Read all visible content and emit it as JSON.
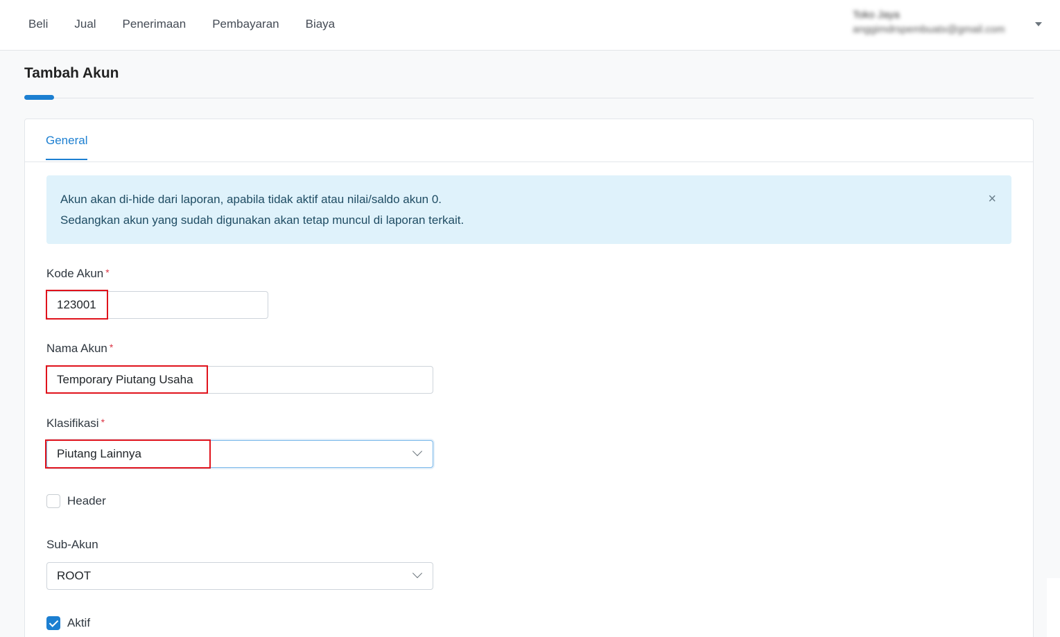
{
  "nav": {
    "items": [
      "Beli",
      "Jual",
      "Penerimaan",
      "Pembayaran",
      "Biaya"
    ]
  },
  "user": {
    "name": "Toko Jaya",
    "email": "anggimdrspembuatx@gmail.com"
  },
  "page": {
    "title": "Tambah Akun"
  },
  "tabs": {
    "general": "General"
  },
  "alert": {
    "line1": "Akun akan di-hide dari laporan, apabila tidak aktif atau nilai/saldo akun 0.",
    "line2": "Sedangkan akun yang sudah digunakan akan tetap muncul di laporan terkait.",
    "close": "×"
  },
  "form": {
    "kode_akun": {
      "label": "Kode Akun",
      "value": "123001",
      "required": "*"
    },
    "nama_akun": {
      "label": "Nama Akun",
      "value": "Temporary Piutang Usaha",
      "required": "*"
    },
    "klasifikasi": {
      "label": "Klasifikasi",
      "value": "Piutang Lainnya",
      "required": "*"
    },
    "header": {
      "label": "Header",
      "checked": false
    },
    "sub_akun": {
      "label": "Sub-Akun",
      "value": "ROOT"
    },
    "aktif": {
      "label": "Aktif",
      "checked": true
    }
  },
  "colors": {
    "accent": "#1c7fd1",
    "highlight": "#e0121b",
    "alert_bg": "#dff2fb"
  }
}
